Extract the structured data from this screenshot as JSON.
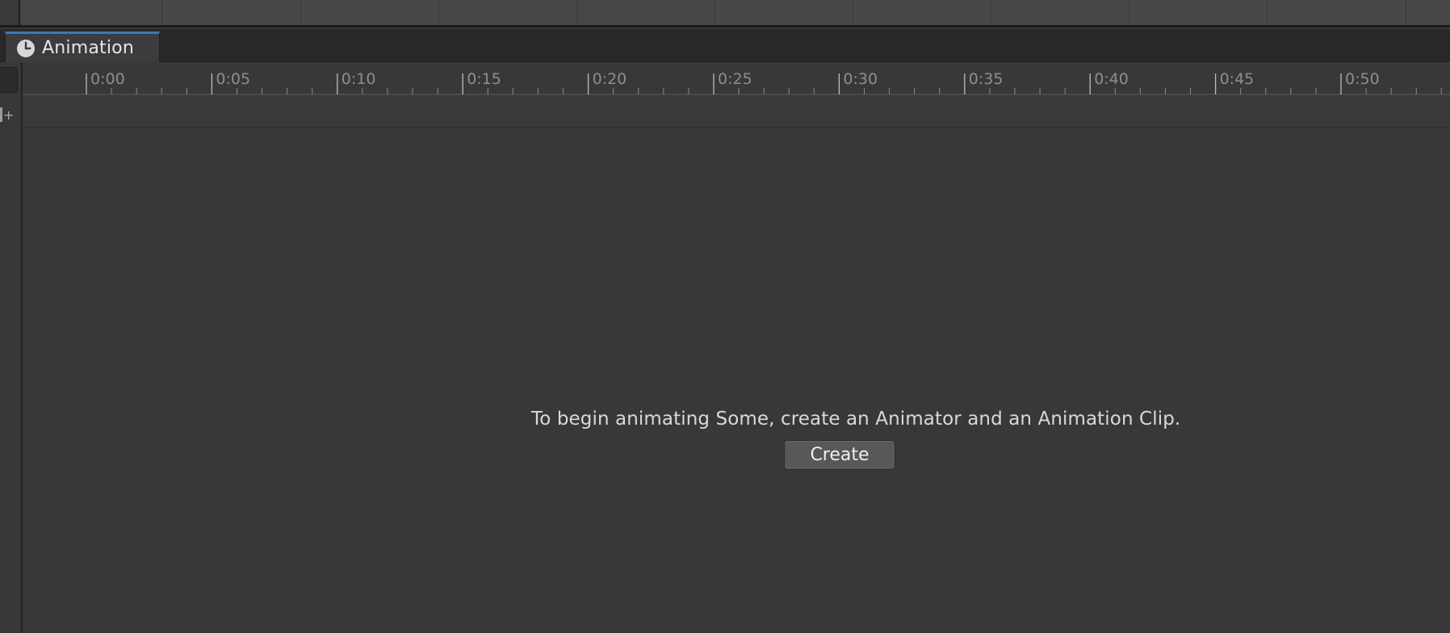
{
  "window": {
    "tab_label": "Animation",
    "tab_icon": "clock-icon",
    "accent_color": "#3a79bb"
  },
  "timeline": {
    "ruler_labels": [
      "0:00",
      "0:05",
      "0:10",
      "0:15",
      "0:20",
      "0:25",
      "0:30",
      "0:35",
      "0:40",
      "0:45",
      "0:50"
    ]
  },
  "left_panel": {
    "add_key_icon": "add-keyframe-icon"
  },
  "empty_state": {
    "message": "To begin animating Some, create an Animator and an Animation Clip.",
    "create_label": "Create"
  }
}
